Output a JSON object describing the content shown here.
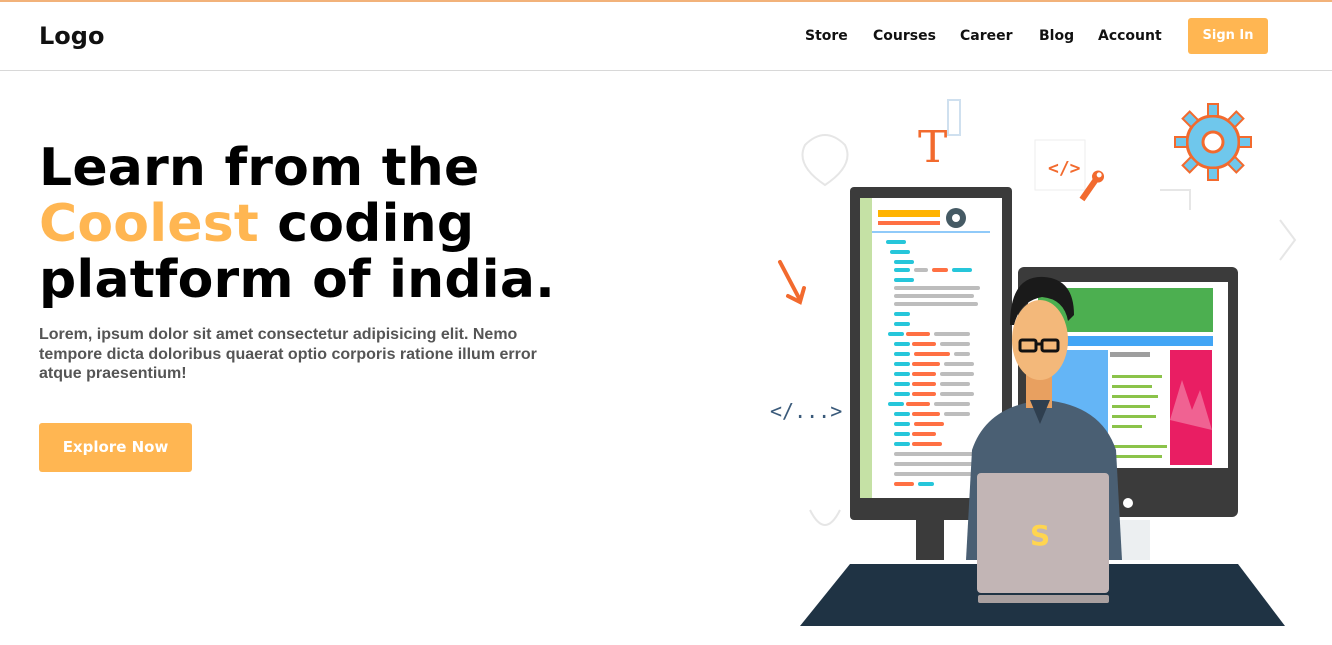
{
  "brand": {
    "logo_text": "Logo"
  },
  "nav": {
    "items": [
      {
        "label": "Store"
      },
      {
        "label": "Courses"
      },
      {
        "label": "Career"
      },
      {
        "label": "Blog"
      },
      {
        "label": "Account"
      }
    ],
    "signin_label": "Sign In"
  },
  "hero": {
    "title_part1": "Learn from the ",
    "title_accent": "Coolest",
    "title_part2": " coding platform of india.",
    "description": "Lorem, ipsum dolor sit amet consectetur adipisicing elit. Nemo tempore dicta doloribus quaerat optio corporis ratione illum error atque praesentium!",
    "cta_label": "Explore Now"
  },
  "colors": {
    "accent": "#ffb652",
    "text": "#000000",
    "muted_text": "#555555",
    "desk": "#1f3344"
  },
  "illustration": {
    "code_tag_text": "</>",
    "code_tag_ellipsis_text": "</...>",
    "letter_t": "T",
    "laptop_logo": "S",
    "icons": [
      "gear-icon",
      "wrench-icon",
      "arrow-icon",
      "code-tag-icon"
    ]
  }
}
